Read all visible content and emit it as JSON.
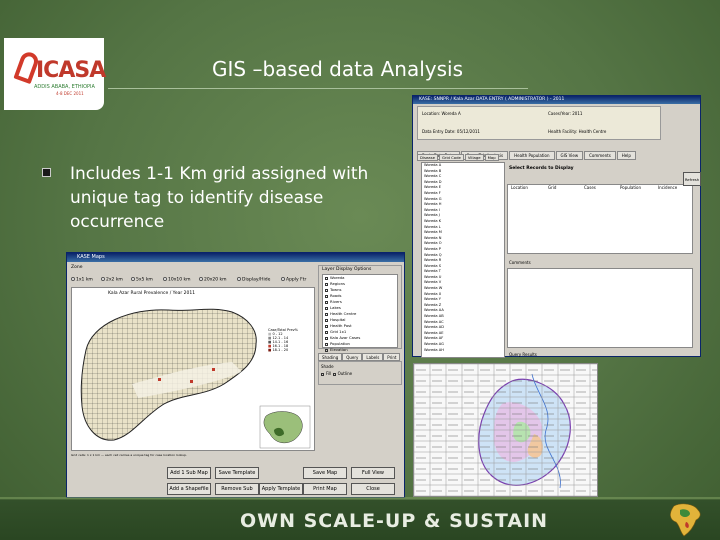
{
  "slide": {
    "title": "GIS –based  data Analysis",
    "bullet_text": "Includes 1-1 Km grid assigned with unique tag to identify disease occurrence",
    "footer": "OWN SCALE-UP & SUSTAIN"
  },
  "logo": {
    "brand": "ICASA",
    "tag": "ADDIS ABABA, ETHIOPIA",
    "tag2": "4-8 DEC 2011"
  },
  "colors": {
    "background": "#557545",
    "title": "#ffffff",
    "logo_red": "#c0392b",
    "footer": "#2a4622"
  },
  "gis_window": {
    "radio_label": "Zone",
    "radios": [
      "1x1 km",
      "2x2 km",
      "5x5 km",
      "10x10 km",
      "20x20 km",
      "Display/Hide",
      "Apply Ftr"
    ],
    "map_title": "Kala Azar Rural Prevalence / Year 2011",
    "legend_title": "Case/Total Prev%",
    "legend_items": [
      "0 - 12",
      "12.1 - 14",
      "14.1 - 16",
      "16.1 - 18",
      "18.1 - 20"
    ],
    "layer_panel_title": "Layer Display Options",
    "layers": [
      "Woreda",
      "Regions",
      "Towns",
      "Roads",
      "Rivers",
      "Lakes",
      "Health Centre",
      "Hospital",
      "Health Post",
      "Grid 1x1",
      "Kala Azar Cases",
      "Population",
      "Elevation"
    ],
    "tabs": [
      "Shading",
      "Query",
      "Labels",
      "Print"
    ],
    "shading_label": "Shade",
    "shade_opt1": "Fill",
    "shade_opt2": "Outline",
    "buttons": [
      "Add 1 Sub Map",
      "Save Template",
      "Save Map",
      "Full View",
      "Add a Shapefile",
      "Remove Sub",
      "Apply Template",
      "Print Map",
      "Close"
    ]
  },
  "data_window": {
    "titlebar": "KASE: SNNPR / Kala Azar DATA ENTRY ( ADMINISTRATOR ) - 2011",
    "info": {
      "label1": "Location: Woreda A",
      "label2": "Cases/Year: 2011",
      "label3": "Data Entry Date: 05/12/2011",
      "label4": "Health Facility: Health Centre"
    },
    "tabs": [
      "Basic Data Entry",
      "Cross Tab Analysis",
      "Health Population",
      "GIS View",
      "Comments",
      "Help"
    ],
    "subtabs": [
      "Disease",
      "Grid Code",
      "Village",
      "Map"
    ],
    "list_items": [
      "Woreda A",
      "Woreda B",
      "Woreda C",
      "Woreda D",
      "Woreda E",
      "Woreda F",
      "Woreda G",
      "Woreda H",
      "Woreda I",
      "Woreda J",
      "Woreda K",
      "Woreda L",
      "Woreda M",
      "Woreda N",
      "Woreda O",
      "Woreda P",
      "Woreda Q",
      "Woreda R",
      "Woreda S",
      "Woreda T",
      "Woreda U",
      "Woreda V",
      "Woreda W",
      "Woreda X",
      "Woreda Y",
      "Woreda Z",
      "Woreda AA",
      "Woreda AB",
      "Woreda AC",
      "Woreda AD",
      "Woreda AE",
      "Woreda AF",
      "Woreda AG",
      "Woreda AH"
    ],
    "right_title": "Select Records to Display",
    "table_cols": [
      "Location",
      "Grid",
      "Cases",
      "Population",
      "Incidence"
    ],
    "side_button": "Refresh",
    "footer_label": "Query Results",
    "extra_label": "Comments"
  },
  "grid_map": {
    "description": "Grid overlay of region with 1x1 km tags"
  }
}
